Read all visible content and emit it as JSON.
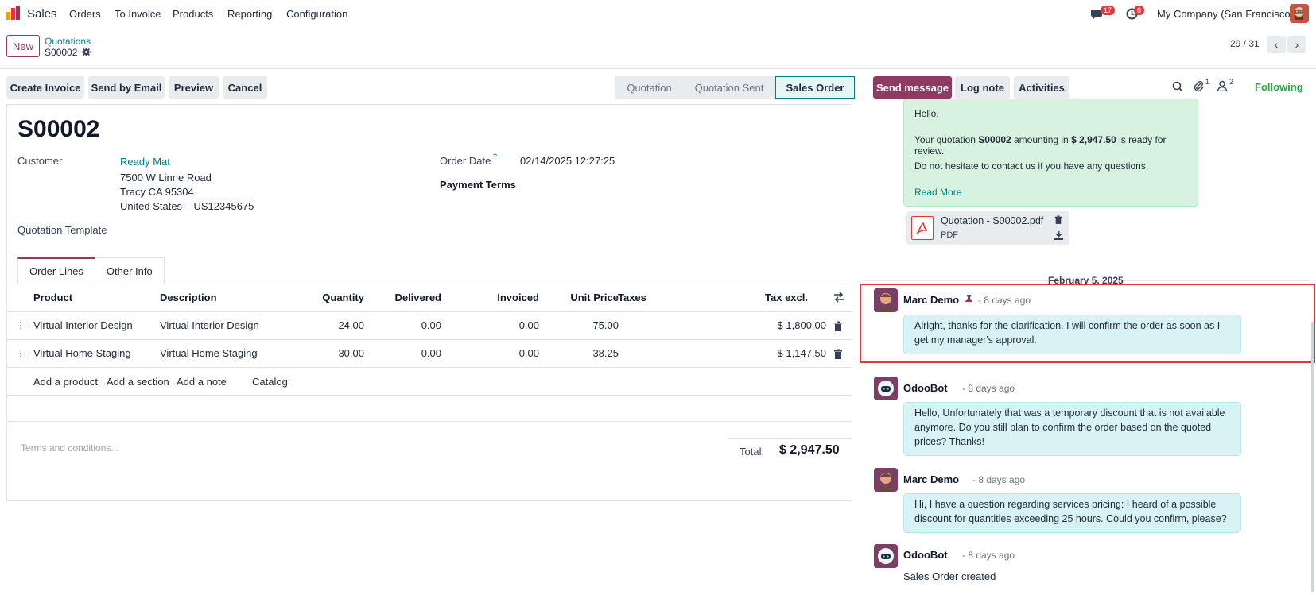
{
  "nav": {
    "app_name": "Sales",
    "menu": [
      "Orders",
      "To Invoice",
      "Products",
      "Reporting",
      "Configuration"
    ],
    "messages_badge": "17",
    "activities_badge": "8",
    "company": "My Company (San Francisco)"
  },
  "control": {
    "new_label": "New",
    "breadcrumb_parent": "Quotations",
    "breadcrumb_current": "S00002",
    "pager": "29 / 31"
  },
  "actions": {
    "create_invoice": "Create Invoice",
    "send_email": "Send by Email",
    "preview": "Preview",
    "cancel": "Cancel"
  },
  "statusbar": {
    "stages": [
      "Quotation",
      "Quotation Sent",
      "Sales Order"
    ],
    "active": "Sales Order"
  },
  "form": {
    "title": "S00002",
    "customer_label": "Customer",
    "customer_name": "Ready Mat",
    "address_line1": "7500 W Linne Road",
    "address_line2": "Tracy CA 95304",
    "address_line3": "United States – US12345675",
    "template_label": "Quotation Template",
    "order_date_label": "Order Date",
    "order_date_help": "?",
    "order_date": "02/14/2025 12:27:25",
    "payment_terms_label": "Payment Terms"
  },
  "tabs": [
    "Order Lines",
    "Other Info"
  ],
  "order_lines": {
    "headers": {
      "product": "Product",
      "description": "Description",
      "quantity": "Quantity",
      "delivered": "Delivered",
      "invoiced": "Invoiced",
      "unit_price": "Unit Price",
      "taxes": "Taxes",
      "tax_excl": "Tax excl."
    },
    "rows": [
      {
        "product": "Virtual Interior Design",
        "description": "Virtual Interior Design",
        "quantity": "24.00",
        "delivered": "0.00",
        "invoiced": "0.00",
        "unit_price": "75.00",
        "subtotal": "$ 1,800.00"
      },
      {
        "product": "Virtual Home Staging",
        "description": "Virtual Home Staging",
        "quantity": "30.00",
        "delivered": "0.00",
        "invoiced": "0.00",
        "unit_price": "38.25",
        "subtotal": "$ 1,147.50"
      }
    ],
    "add_product": "Add a product",
    "add_section": "Add a section",
    "add_note": "Add a note",
    "catalog": "Catalog"
  },
  "footer": {
    "terms_placeholder": "Terms and conditions...",
    "total_label": "Total:",
    "total_value": "$ 2,947.50"
  },
  "chatter": {
    "send_message": "Send message",
    "log_note": "Log note",
    "activities": "Activities",
    "attachments_count": "1",
    "followers_count": "2",
    "following": "Following",
    "email": {
      "hello": "Hello,",
      "line_prefix": "Your quotation ",
      "ref": "S00002",
      "line_mid": " amounting in ",
      "amount": "$ 2,947.50",
      "line_suffix": " is ready for review.",
      "line2": "Do not hesitate to contact us if you have any questions.",
      "read_more": "Read More"
    },
    "attachment": {
      "name": "Quotation - S00002.pdf",
      "type": "PDF"
    },
    "date_separator": "February 5, 2025",
    "messages": [
      {
        "author": "Marc Demo",
        "time": "- 8 days ago",
        "text": "Alright, thanks for the clarification. I will confirm the order as soon as I get my manager's approval."
      },
      {
        "author": "OdooBot",
        "time": "- 8 days ago",
        "text": "Hello, Unfortunately that was a temporary discount that is not available anymore. Do you still plan to confirm the order based on the quoted prices? Thanks!"
      },
      {
        "author": "Marc Demo",
        "time": "- 8 days ago",
        "text": "Hi, I have a question regarding services pricing: I heard of a possible discount for quantities exceeding 25 hours. Could you confirm, please?"
      },
      {
        "author": "OdooBot",
        "time": "- 8 days ago",
        "text": "Sales Order created"
      }
    ]
  }
}
